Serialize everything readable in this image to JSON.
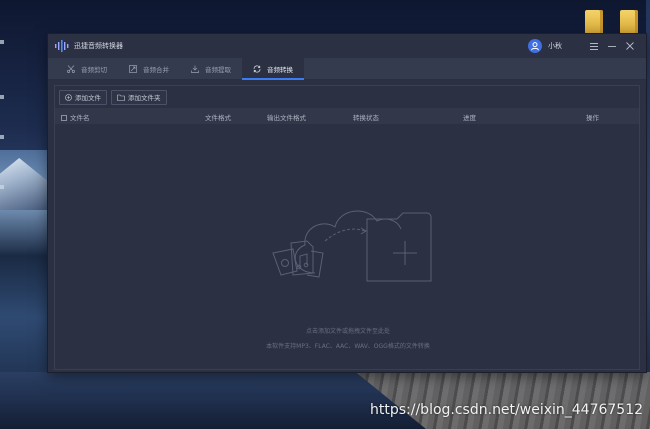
{
  "window": {
    "title": "迅捷音频转换器",
    "username": "小秋"
  },
  "tabs": [
    {
      "label": "音频剪切",
      "icon": "scissors-icon"
    },
    {
      "label": "音频合并",
      "icon": "merge-icon"
    },
    {
      "label": "音频提取",
      "icon": "extract-icon"
    },
    {
      "label": "音频转换",
      "icon": "convert-icon",
      "active": true
    }
  ],
  "toolbar": {
    "add_file": "添加文件",
    "add_folder": "添加文件夹"
  },
  "table": {
    "columns": [
      "文件名",
      "文件格式",
      "输出文件格式",
      "转换状态",
      "进度",
      "操作"
    ]
  },
  "empty_state": {
    "line1": "点击添加文件或拖拽文件至此处",
    "line2": "本软件支持MP3、FLAC、AAC、WAV、OGG格式的文件转换"
  },
  "watermark": "https://blog.csdn.net/weixin_44767512",
  "colors": {
    "accent": "#3b7cf0",
    "window_bg": "#2b3042",
    "tabbar_bg": "#353b4f"
  }
}
